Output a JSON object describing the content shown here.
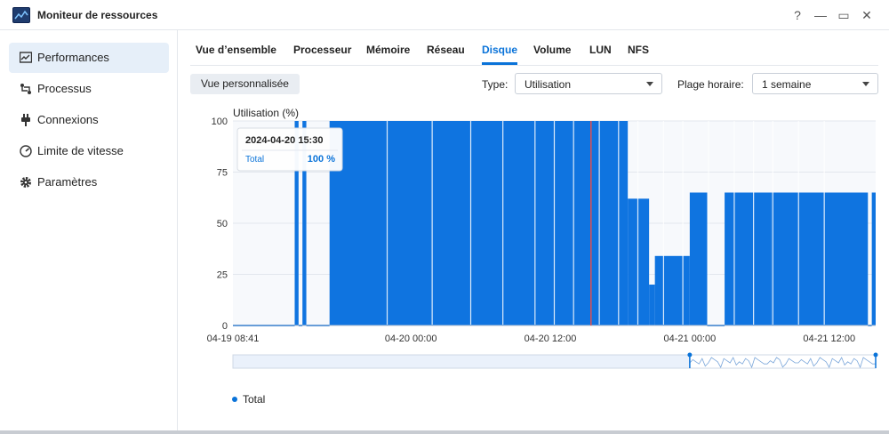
{
  "window": {
    "title": "Moniteur de ressources",
    "controls": [
      "?",
      "—",
      "▭",
      "✕"
    ]
  },
  "sidebar": {
    "items": [
      {
        "label": "Performances",
        "icon": "performance-icon",
        "active": true
      },
      {
        "label": "Processus",
        "icon": "process-icon",
        "active": false
      },
      {
        "label": "Connexions",
        "icon": "plug-icon",
        "active": false
      },
      {
        "label": "Limite de vitesse",
        "icon": "speedometer-icon",
        "active": false
      },
      {
        "label": "Paramètres",
        "icon": "gear-icon",
        "active": false
      }
    ]
  },
  "tabs": [
    {
      "label": "Vue d’ensemble",
      "active": false
    },
    {
      "label": "Processeur",
      "active": false
    },
    {
      "label": "Mémoire",
      "active": false
    },
    {
      "label": "Réseau",
      "active": false
    },
    {
      "label": "Disque",
      "active": true
    },
    {
      "label": "Volume",
      "active": false
    },
    {
      "label": "LUN",
      "active": false
    },
    {
      "label": "NFS",
      "active": false
    }
  ],
  "toolbar": {
    "custom_view_label": "Vue personnalisée",
    "type_label": "Type:",
    "type_value": "Utilisation",
    "range_label": "Plage horaire:",
    "range_value": "1 semaine"
  },
  "colors": {
    "accent": "#0a73d9",
    "series": "#0f74e0",
    "cursor": "#e05050"
  },
  "chart_data": {
    "type": "area",
    "ylabel": "Utilisation (%)",
    "ylim": [
      0,
      100
    ],
    "yticks": [
      0,
      25,
      50,
      75,
      100
    ],
    "xlim": [
      "2024-04-19 08:41",
      "2024-04-21 16:00"
    ],
    "xticks": [
      "2024-04-19 08:41",
      "2024-04-20 00:00",
      "2024-04-20 12:00",
      "2024-04-21 00:00",
      "2024-04-21 12:00"
    ],
    "xtick_labels": [
      "04-19 08:41",
      "04-20 00:00",
      "04-20 12:00",
      "04-21 00:00",
      "04-21 12:00"
    ],
    "grid": true,
    "legend": {
      "position": "bottom-left",
      "entries": [
        "Total"
      ]
    },
    "cursor": "2024-04-20 15:30",
    "tooltip": {
      "title": "2024-04-20 15:30",
      "series": "Total",
      "value": "100 %"
    },
    "series": [
      {
        "name": "Total",
        "segments": [
          {
            "start": "2024-04-19 08:41",
            "end": "2024-04-19 14:00",
            "value": 0
          },
          {
            "start": "2024-04-19 14:00",
            "end": "2024-04-19 14:20",
            "value": 100
          },
          {
            "start": "2024-04-19 14:20",
            "end": "2024-04-19 14:40",
            "value": 0
          },
          {
            "start": "2024-04-19 14:40",
            "end": "2024-04-19 15:00",
            "value": 100
          },
          {
            "start": "2024-04-19 15:00",
            "end": "2024-04-19 17:00",
            "value": 0
          },
          {
            "start": "2024-04-19 17:00",
            "end": "2024-04-20 18:40",
            "value": 100
          },
          {
            "start": "2024-04-20 18:40",
            "end": "2024-04-20 20:30",
            "value": 62
          },
          {
            "start": "2024-04-20 20:30",
            "end": "2024-04-20 21:00",
            "value": 20
          },
          {
            "start": "2024-04-20 21:00",
            "end": "2024-04-21 00:00",
            "value": 34
          },
          {
            "start": "2024-04-21 00:00",
            "end": "2024-04-21 01:30",
            "value": 65
          },
          {
            "start": "2024-04-21 01:30",
            "end": "2024-04-21 03:00",
            "value": 0
          },
          {
            "start": "2024-04-21 03:00",
            "end": "2024-04-21 07:00",
            "value": 65
          },
          {
            "start": "2024-04-21 07:00",
            "end": "2024-04-21 15:20",
            "value": 65
          },
          {
            "start": "2024-04-21 15:20",
            "end": "2024-04-21 15:40",
            "value": 0
          },
          {
            "start": "2024-04-21 15:40",
            "end": "2024-04-21 16:00",
            "value": 65
          }
        ]
      }
    ],
    "navigator": {
      "selection": [
        "2024-04-21 00:00",
        "2024-04-21 16:00"
      ]
    }
  }
}
